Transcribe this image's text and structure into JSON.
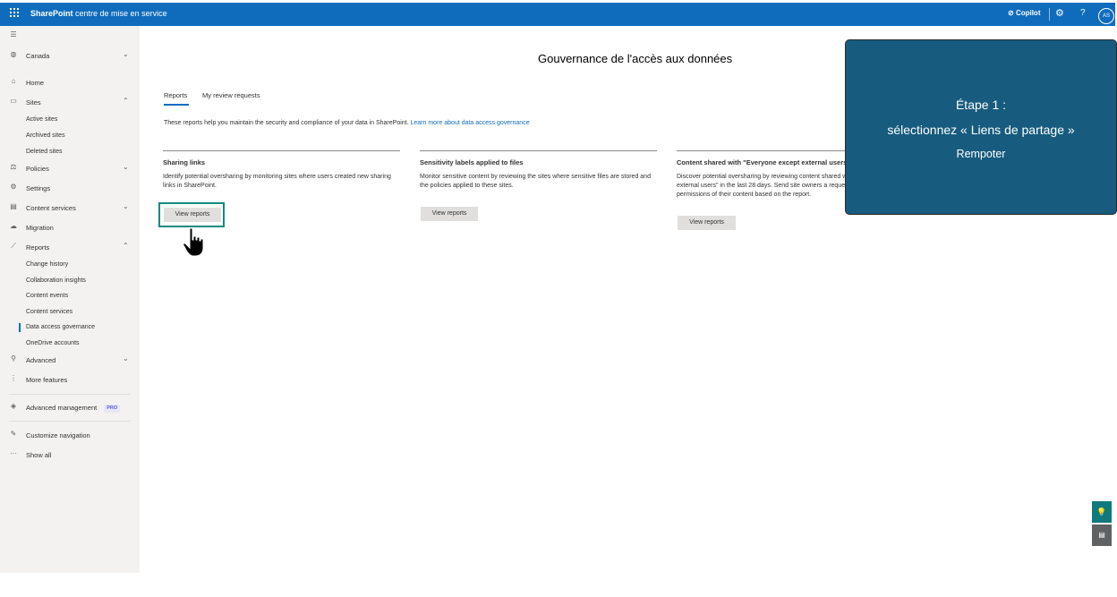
{
  "topbar": {
    "app_title_bold": "SharePoint",
    "app_title_rest": "centre de mise en service",
    "copilot": "Copilot",
    "avatar": "AS",
    "accent": "#0f6cbd"
  },
  "sidebar": {
    "region": "Canada",
    "home": "Home",
    "sites": "Sites",
    "sites_sub": [
      "Active sites",
      "Archived sites",
      "Deleted sites"
    ],
    "policies": "Policies",
    "settings": "Settings",
    "content_services": "Content services",
    "migration": "Migration",
    "reports": "Reports",
    "reports_sub": [
      "Change history",
      "Collaboration insights",
      "Content events",
      "Content services",
      "Data access governance",
      "OneDrive accounts"
    ],
    "advanced": "Advanced",
    "more_features": "More features",
    "advanced_management": "Advanced management",
    "pro_badge": "PRO",
    "customize_navigation": "Customize navigation",
    "show_all": "Show all"
  },
  "main": {
    "title": "Gouvernance de l'accès aux données",
    "tabs": [
      "Reports",
      "My review requests"
    ],
    "intro": "These reports help you maintain the security and compliance of your data in SharePoint.",
    "intro_link": "Learn more about data access governance",
    "cards": [
      {
        "title": "Sharing links",
        "desc": "Identify potential oversharing by monitoring sites where users created new sharing links in SharePoint.",
        "button": "View reports"
      },
      {
        "title": "Sensitivity labels applied to files",
        "desc": "Monitor sensitive content by reviewing the sites where sensitive files are stored and the policies applied to these sites.",
        "button": "View reports"
      },
      {
        "title": "Content shared with \"Everyone except external users\"",
        "desc": "Discover potential oversharing by reviewing content shared with \"Everyone except external users\" in the last 28 days. Send site owners a request to review access permissions of their content based on the report.",
        "button": "View reports"
      }
    ]
  },
  "callout": {
    "line1": "Étape 1 :",
    "line2": "sélectionnez « Liens de partage »",
    "line3": "Rempoter",
    "background": "#175b7e"
  },
  "icons": {
    "waffle": "waffle-icon",
    "gear": "gear-icon",
    "help": "help-icon",
    "hand_cursor": "hand-pointer-icon"
  }
}
